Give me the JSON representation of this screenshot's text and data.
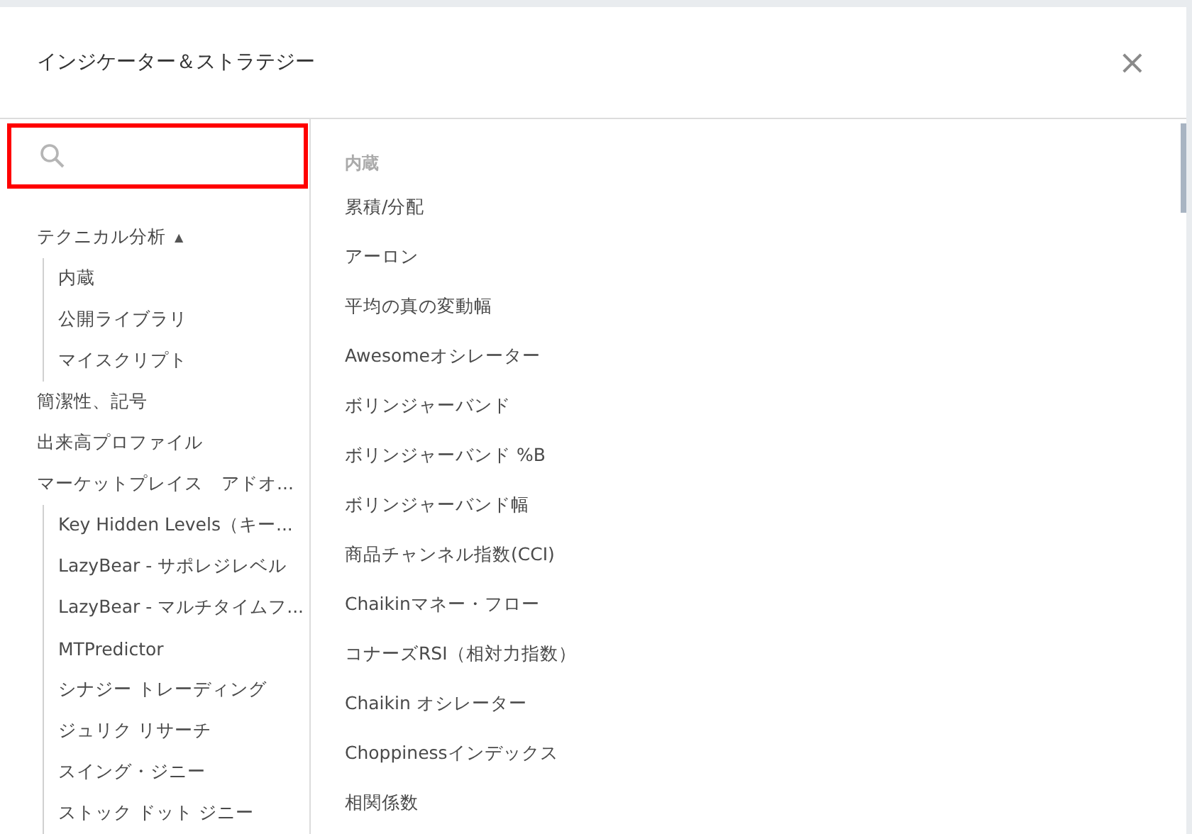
{
  "dialog": {
    "title": "インジケーター＆ストラテジー",
    "close": "×"
  },
  "search": {
    "highlighted": true
  },
  "sidebar": {
    "items": [
      {
        "label": "テクニカル分析",
        "arrow": "▲",
        "children": [
          {
            "label": "内蔵"
          },
          {
            "label": "公開ライブラリ"
          },
          {
            "label": "マイスクリプト"
          }
        ]
      },
      {
        "label": "簡潔性、記号"
      },
      {
        "label": "出来高プロファイル"
      },
      {
        "label": "マーケットプレイス　アドオ...",
        "children": [
          {
            "label": "Key Hidden Levels（キー..."
          },
          {
            "label": "LazyBear - サポレジレベル"
          },
          {
            "label": "LazyBear - マルチタイムフ..."
          },
          {
            "label": "MTPredictor"
          },
          {
            "label": "シナジー トレーディング"
          },
          {
            "label": "ジュリク リサーチ"
          },
          {
            "label": "スイング・ジニー"
          },
          {
            "label": "ストック ドット ジニー"
          }
        ]
      }
    ]
  },
  "list": {
    "heading": "内蔵",
    "items": [
      "累積/分配",
      "アーロン",
      "平均の真の変動幅",
      "Awesomeオシレーター",
      "ボリンジャーバンド",
      "ボリンジャーバンド %B",
      "ボリンジャーバンド幅",
      "商品チャンネル指数(CCI)",
      "Chaikinマネー・フロー",
      "コナーズRSI（相対力指数）",
      "Chaikin オシレーター",
      "Choppinessインデックス",
      "相関係数"
    ]
  }
}
